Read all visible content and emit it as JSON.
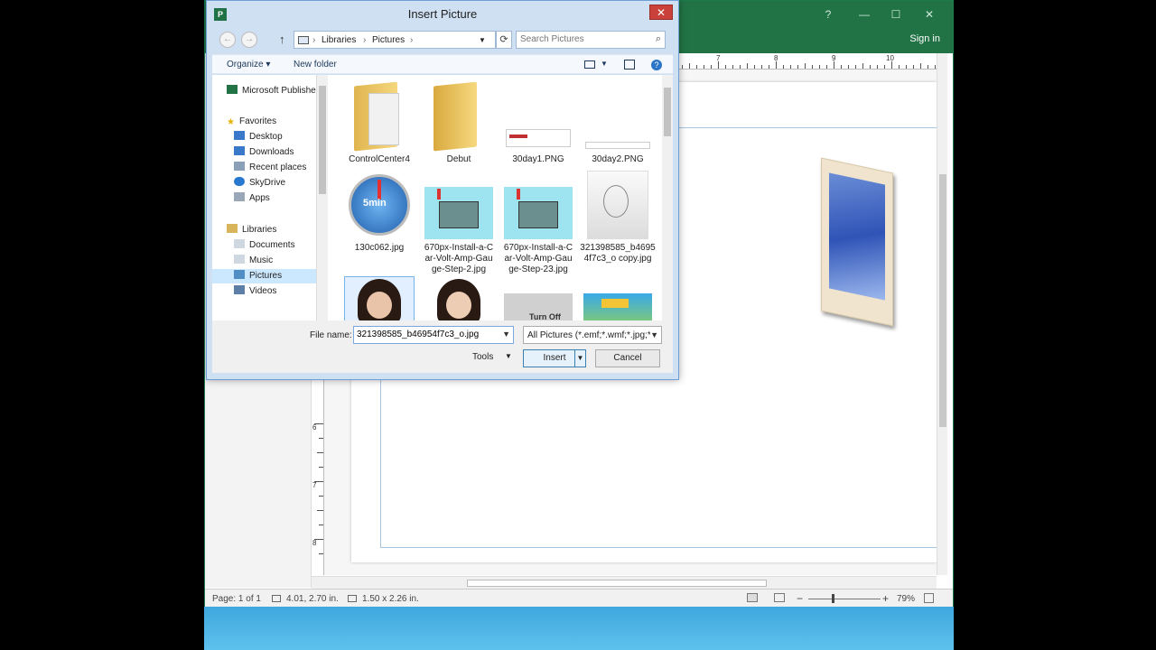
{
  "publisher": {
    "title_controls": [
      "?",
      "—",
      "☐",
      "✕"
    ],
    "sign_in": "Sign in",
    "ruler_numbers": [
      "7",
      "8",
      "9",
      "10"
    ],
    "left_ruler_numbers": [
      "6",
      "7",
      "8"
    ],
    "status": {
      "page": "Page: 1 of 1",
      "position": "4.01, 2.70 in.",
      "size": "1.50 x 2.26 in.",
      "zoom": "79%"
    }
  },
  "dialog": {
    "title": "Insert Picture",
    "app_icon_letter": "P",
    "close": "✕",
    "breadcrumb": [
      "Libraries",
      "Pictures"
    ],
    "search_placeholder": "Search Pictures",
    "toolbar": {
      "organize": "Organize ▾",
      "new_folder": "New folder"
    },
    "nav": {
      "top_item": "Microsoft Publisher",
      "favorites_header": "Favorites",
      "favorites": [
        "Desktop",
        "Downloads",
        "Recent places",
        "SkyDrive",
        "Apps"
      ],
      "libraries_header": "Libraries",
      "libraries": [
        "Documents",
        "Music",
        "Pictures",
        "Videos"
      ]
    },
    "files": [
      {
        "name": "ControlCenter4"
      },
      {
        "name": "Debut"
      },
      {
        "name": "30day1.PNG"
      },
      {
        "name": "30day2.PNG"
      },
      {
        "name": "130c062.jpg"
      },
      {
        "name": "670px-Install-a-Car-Volt-Amp-Gauge-Step-2.jpg",
        "line1": "670px-Install-a-C",
        "line2": "ar-Volt-Amp-Gau",
        "line3": "ge-Step-2.jpg"
      },
      {
        "name": "670px-Install-a-Car-Volt-Amp-Gauge-Step-23.jpg",
        "line1": "670px-Install-a-C",
        "line2": "ar-Volt-Amp-Gau",
        "line3": "ge-Step-23.jpg"
      },
      {
        "name": "321398585_b46954f7c3_o copy.jpg",
        "line1": "321398585_b4695",
        "line2": "4f7c3_o copy.jpg"
      }
    ],
    "timer_text": "5min",
    "file_name_label": "File name:",
    "file_name_value": "321398585_b46954f7c3_o.jpg",
    "file_type_value": "All Pictures (*.emf;*.wmf;*.jpg;*",
    "tools_label": "Tools",
    "insert_label": "Insert",
    "cancel_label": "Cancel",
    "turnoff_text": "Turn Off"
  }
}
